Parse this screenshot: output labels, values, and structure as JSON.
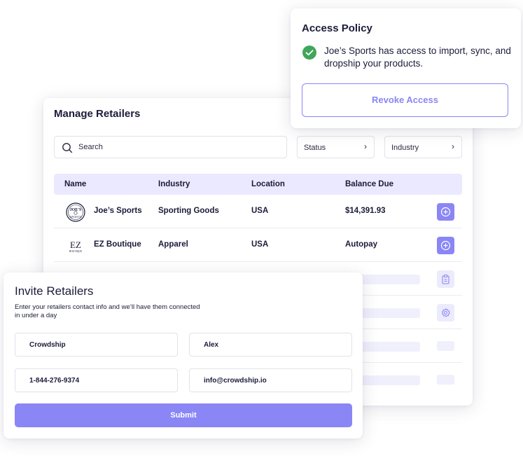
{
  "manage": {
    "title": "Manage Retailers",
    "search_label": "Search",
    "status_filter": "Status",
    "industry_filter": "Industry",
    "columns": [
      "Name",
      "Industry",
      "Location",
      "Balance Due"
    ],
    "rows": [
      {
        "name": "Joe’s Sports",
        "industry": "Sporting Goods",
        "location": "USA",
        "balance": "$14,391.93",
        "action_icon": "plus-circle-icon"
      },
      {
        "name": "EZ Boutique",
        "industry": "Apparel",
        "location": "USA",
        "balance": "Autopay",
        "action_icon": "plus-circle-icon"
      }
    ],
    "placeholder_row_icons": [
      "clipboard-icon",
      "gear-icon"
    ]
  },
  "access": {
    "title": "Access Policy",
    "message": "Joe’s Sports has access to import, sync, and dropship your products.",
    "revoke_label": "Revoke Access"
  },
  "invite": {
    "title": "Invite Retailers",
    "description": "Enter your retailers contact info and we’ll have them connected in under a day",
    "company": "Crowdship",
    "first_name": "Alex",
    "phone": "1-844-276-9374",
    "email": "info@crowdship.io",
    "submit_label": "Submit"
  },
  "logos": {
    "joes_sports": {
      "top": "JOE'S",
      "bottom": "SPORTS"
    },
    "ez_boutique": {
      "mark": "EZ",
      "sub": "BOUTIQUE"
    }
  },
  "colors": {
    "accent": "#8a86f5",
    "header_bg": "#ebe9ff",
    "success": "#3fa65a",
    "text": "#1b1b3a"
  }
}
